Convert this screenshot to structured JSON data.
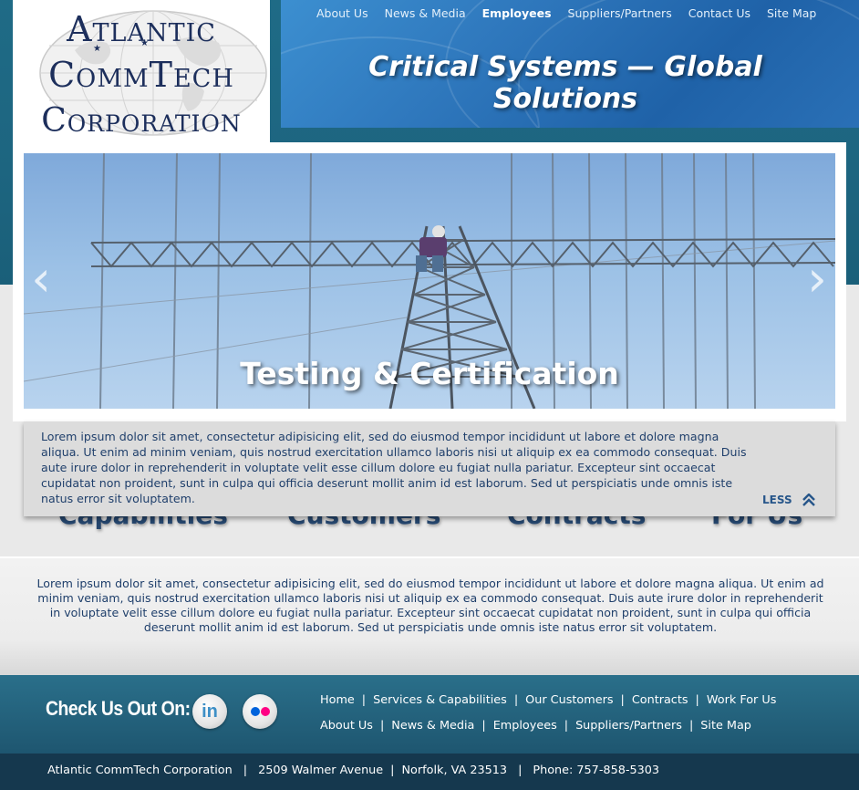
{
  "header": {
    "logo_lines": [
      "Atlantic",
      "CommTech",
      "Corporation"
    ],
    "tagline": "Critical Systems — Global Solutions",
    "top_nav": [
      {
        "label": "About Us",
        "active": false
      },
      {
        "label": "News & Media",
        "active": false
      },
      {
        "label": "Employees",
        "active": true
      },
      {
        "label": "Suppliers/Partners",
        "active": false
      },
      {
        "label": "Contact Us",
        "active": false
      },
      {
        "label": "Site Map",
        "active": false
      }
    ]
  },
  "slider": {
    "title": "Testing & Certification",
    "prev_icon": "chevron-left-icon",
    "next_icon": "chevron-right-icon",
    "description": "Lorem ipsum dolor sit amet, consectetur adipisicing elit, sed do eiusmod tempor incididunt ut labore et dolore magna aliqua. Ut enim ad minim veniam, quis nostrud exercitation ullamco laboris nisi ut aliquip ex ea commodo consequat. Duis aute irure dolor in reprehenderit in voluptate velit esse cillum dolore eu fugiat nulla pariatur. Excepteur sint occaecat cupidatat non proident, sunt in culpa qui officia deserunt mollit anim id est laborum. Sed ut perspiciatis unde omnis iste natus error sit voluptatem.",
    "less_label": "LESS",
    "less_icon": "double-chevron-up-icon"
  },
  "categories": [
    "Capabilities",
    "Customers",
    "Contracts",
    "For Us"
  ],
  "main": {
    "text": "Lorem ipsum dolor sit amet, consectetur adipisicing elit, sed do eiusmod tempor incididunt ut labore et dolore magna aliqua. Ut enim ad minim veniam, quis nostrud exercitation ullamco laboris nisi ut aliquip ex ea commodo consequat. Duis aute irure dolor in reprehenderit in voluptate velit esse cillum dolore eu fugiat nulla pariatur. Excepteur sint occaecat cupidatat non proident, sunt in culpa qui officia deserunt mollit anim id est laborum. Sed ut perspiciatis unde omnis iste natus error sit voluptatem."
  },
  "footer": {
    "check_us": "Check Us Out On:",
    "social": [
      {
        "name": "linkedin-icon",
        "glyph": "in"
      },
      {
        "name": "flickr-icon"
      }
    ],
    "nav_row1": [
      "Home",
      "Services & Capabilities",
      "Our Customers",
      "Contracts",
      "Work For Us"
    ],
    "nav_row2": [
      "About Us",
      "News & Media",
      "Employees",
      "Suppliers/Partners",
      "Site Map"
    ],
    "address": {
      "company": "Atlantic CommTech Corporation",
      "street": "2509 Walmer Avenue",
      "city": "Norfolk, VA  23513",
      "phone": "Phone:  757-858-5303"
    },
    "separator": "|"
  },
  "colors": {
    "header_bg": "#1f6b86",
    "banner_blue": "#2f78bd",
    "text_navy": "#1f3f6b",
    "footer_dark": "#15384e",
    "flickr_blue": "#0063dc",
    "flickr_pink": "#ff0084"
  }
}
